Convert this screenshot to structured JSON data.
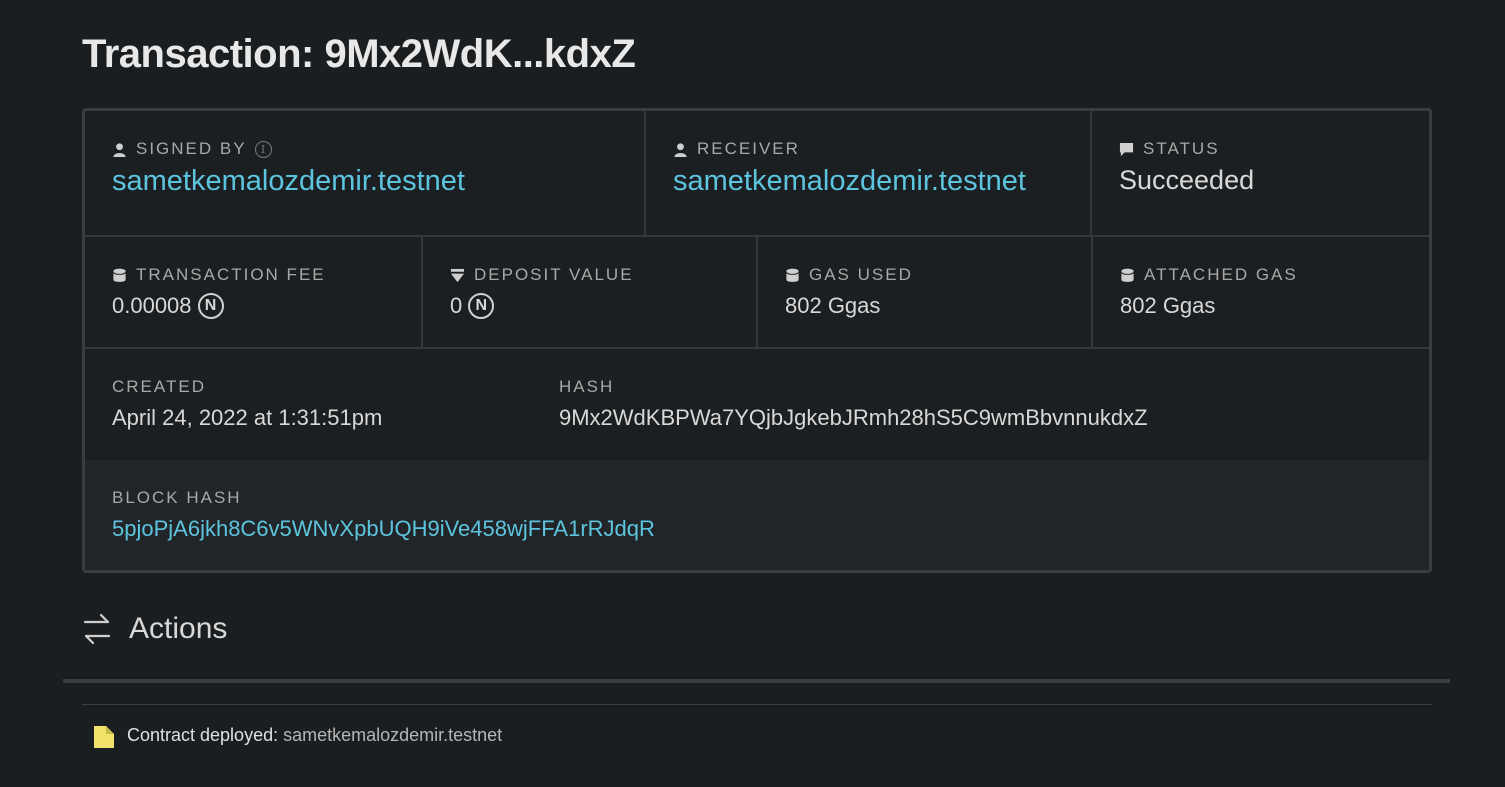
{
  "page": {
    "title": "Transaction: 9Mx2WdK...kdxZ"
  },
  "summary": {
    "signed_by": {
      "label": "Signed by",
      "icon": "user-icon",
      "value": "sametkemalozdemir.testnet"
    },
    "receiver": {
      "label": "Receiver",
      "icon": "user-icon",
      "value": "sametkemalozdemir.testnet"
    },
    "status": {
      "label": "Status",
      "icon": "comment-icon",
      "value": "Succeeded"
    },
    "transaction_fee": {
      "label": "Transaction fee",
      "icon": "coins-icon",
      "value": "0.00008",
      "unit_icon": "near-icon",
      "unit_glyph": "N"
    },
    "deposit_value": {
      "label": "Deposit value",
      "icon": "filter-icon",
      "value": "0",
      "unit_icon": "near-icon",
      "unit_glyph": "N"
    },
    "gas_used": {
      "label": "Gas used",
      "icon": "coins-icon",
      "value": "802 Ggas"
    },
    "attached_gas": {
      "label": "Attached gas",
      "icon": "coins-icon",
      "value": "802 Ggas"
    },
    "created": {
      "label": "Created",
      "value": "April 24, 2022 at 1:31:51pm"
    },
    "hash": {
      "label": "Hash",
      "value": "9Mx2WdKBPWa7YQjbJgkebJRmh28hS5C9wmBbvnnukdxZ"
    },
    "block_hash": {
      "label": "Block hash",
      "value": "5pjoPjA6jkh8C6v5WNvXpbUQH9iVe458wjFFA1rRJdqR"
    },
    "info_glyph": "i"
  },
  "actions": {
    "title": "Actions",
    "icon": "swap-arrows-icon",
    "items": [
      {
        "icon": "file-icon",
        "label": "Contract deployed:",
        "value": "sametkemalozdemir.testnet"
      }
    ]
  },
  "colors": {
    "background": "#1b1e20",
    "link": "#5cc4de",
    "border": "#3a3d40",
    "file_icon": "#f0e26a"
  }
}
